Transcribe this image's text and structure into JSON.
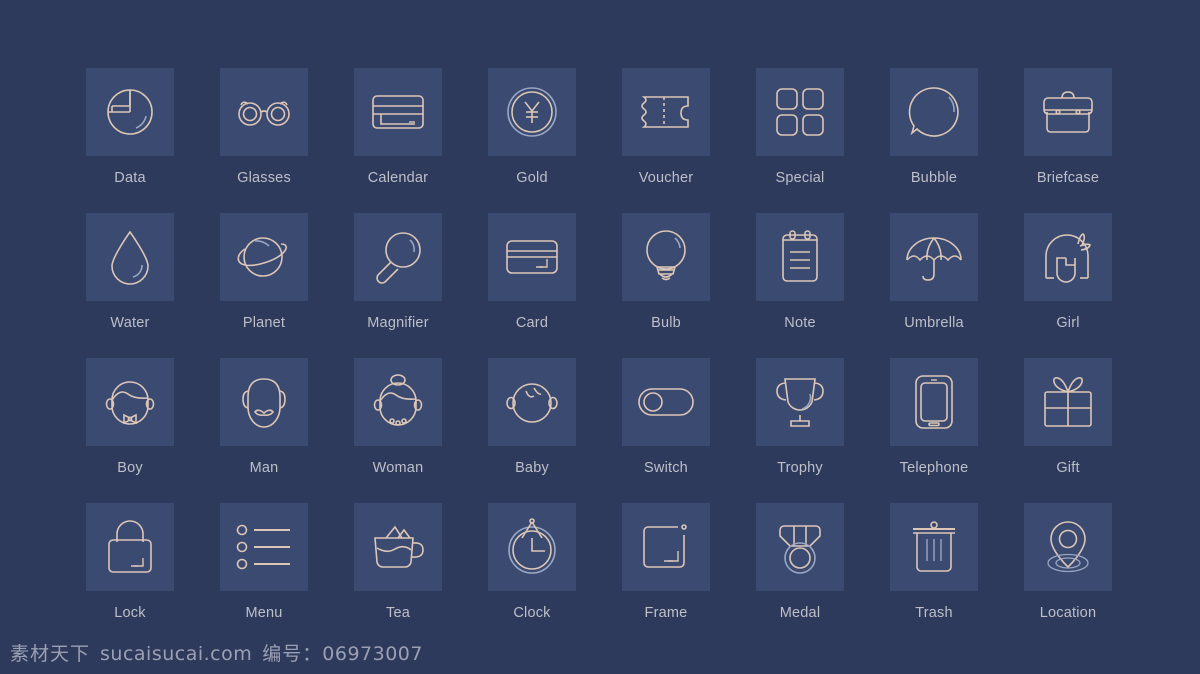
{
  "page": {
    "background_color": "#2e3a5c",
    "tile_color": "#3a4a70",
    "icon_stroke_color": "#dcc6b8",
    "label_color": "#bdbfc9"
  },
  "icons": [
    [
      {
        "name": "Data",
        "icon": "pie-chart-icon"
      },
      {
        "name": "Glasses",
        "icon": "glasses-icon"
      },
      {
        "name": "Calendar",
        "icon": "credit-card-calendar-icon"
      },
      {
        "name": "Gold",
        "icon": "yen-coin-icon"
      },
      {
        "name": "Voucher",
        "icon": "ticket-icon"
      },
      {
        "name": "Special",
        "icon": "four-squares-grid-icon"
      },
      {
        "name": "Bubble",
        "icon": "circle-bubble-icon"
      },
      {
        "name": "Briefcase",
        "icon": "briefcase-icon"
      }
    ],
    [
      {
        "name": "Water",
        "icon": "water-drop-icon"
      },
      {
        "name": "Planet",
        "icon": "planet-saturn-icon"
      },
      {
        "name": "Magnifier",
        "icon": "magnifying-glass-icon"
      },
      {
        "name": "Card",
        "icon": "bank-card-icon"
      },
      {
        "name": "Bulb",
        "icon": "light-bulb-icon"
      },
      {
        "name": "Note",
        "icon": "notepad-icon"
      },
      {
        "name": "Umbrella",
        "icon": "umbrella-icon"
      },
      {
        "name": "Girl",
        "icon": "girl-head-icon"
      }
    ],
    [
      {
        "name": "Boy",
        "icon": "boy-head-icon"
      },
      {
        "name": "Man",
        "icon": "man-head-icon"
      },
      {
        "name": "Woman",
        "icon": "woman-head-icon"
      },
      {
        "name": "Baby",
        "icon": "baby-head-icon"
      },
      {
        "name": "Switch",
        "icon": "toggle-switch-icon"
      },
      {
        "name": "Trophy",
        "icon": "trophy-icon"
      },
      {
        "name": "Telephone",
        "icon": "smartphone-icon"
      },
      {
        "name": "Gift",
        "icon": "gift-box-icon"
      }
    ],
    [
      {
        "name": "Lock",
        "icon": "padlock-icon"
      },
      {
        "name": "Menu",
        "icon": "bulleted-list-icon"
      },
      {
        "name": "Tea",
        "icon": "tea-cup-icon"
      },
      {
        "name": "Clock",
        "icon": "pocket-clock-icon"
      },
      {
        "name": "Frame",
        "icon": "rounded-frame-icon"
      },
      {
        "name": "Medal",
        "icon": "medal-icon"
      },
      {
        "name": "Trash",
        "icon": "trash-bin-icon"
      },
      {
        "name": "Location",
        "icon": "map-pin-icon"
      }
    ]
  ],
  "footer": {
    "site_name": "素材天下",
    "site_url": "sucaisucai.com",
    "id_label": "编号：",
    "id_value": "06973007"
  }
}
